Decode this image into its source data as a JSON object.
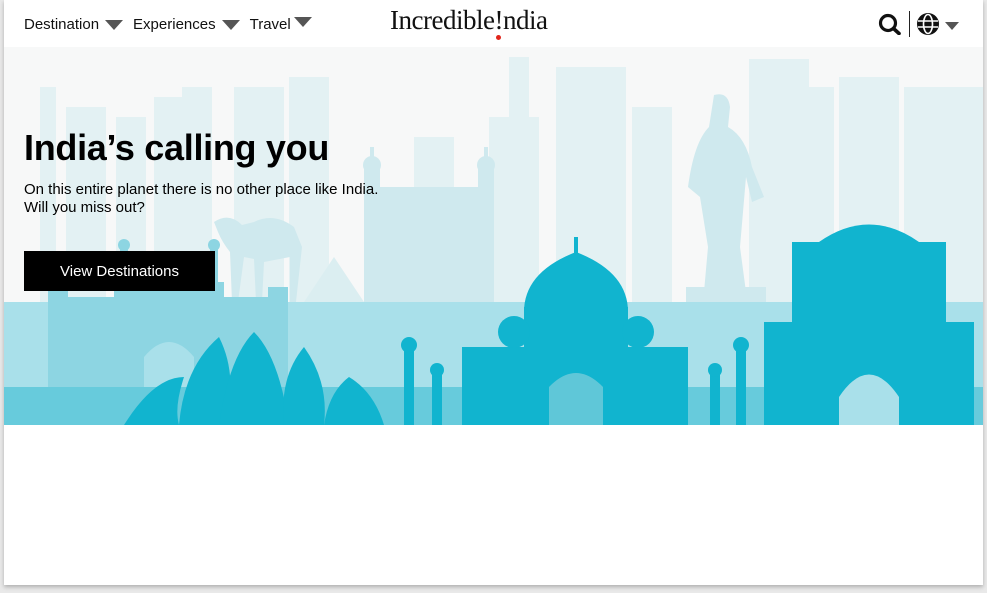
{
  "header": {
    "nav": [
      {
        "label": "Destination"
      },
      {
        "label": "Experiences"
      },
      {
        "label": "Travel"
      }
    ],
    "logo": {
      "part1": "Incredible",
      "mark": "!",
      "part2": "ndia"
    }
  },
  "hero": {
    "title": "India’s calling you",
    "line1": "On this entire planet there is no other place like India.",
    "line2": "Will you miss out?",
    "cta_label": "View Destinations"
  },
  "colors": {
    "brand_red": "#e1251b",
    "skyline_light": "#dbeef1",
    "skyline_mid": "#a7dfe8",
    "skyline_dark": "#11b4cf"
  },
  "icons": [
    "caret-down-icon",
    "search-icon",
    "globe-icon"
  ]
}
